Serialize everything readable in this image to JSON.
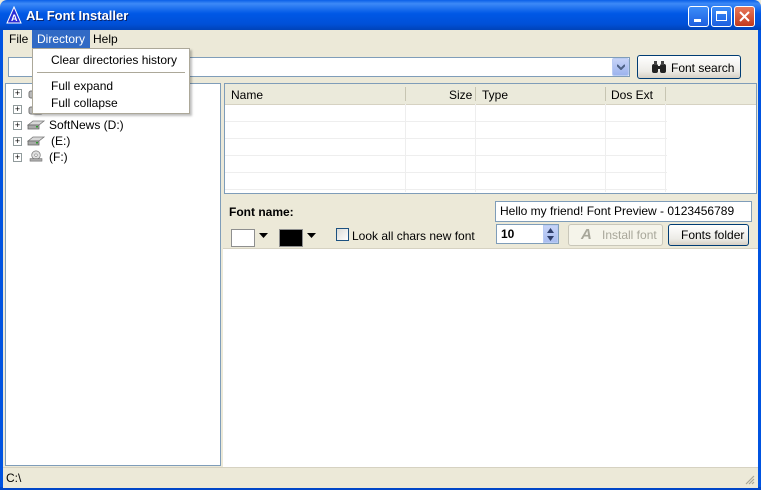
{
  "window": {
    "title": "AL Font Installer"
  },
  "menu": {
    "items": [
      "File",
      "Directory",
      "Help"
    ],
    "open_menu": "Directory",
    "directory_items": [
      "Clear directories history",
      "Full expand",
      "Full collapse"
    ]
  },
  "toolbar": {
    "path_value": "",
    "search_button": "Font search"
  },
  "tree": {
    "items": [
      {
        "label": "",
        "icon": "floppy-icon"
      },
      {
        "label": "",
        "icon": "drive-icon"
      },
      {
        "label": "SoftNews (D:)",
        "icon": "drive-icon"
      },
      {
        "label": "(E:)",
        "icon": "drive-icon"
      },
      {
        "label": "(F:)",
        "icon": "cd-drive-icon"
      }
    ]
  },
  "list": {
    "columns": [
      "Name",
      "Size",
      "Type",
      "Dos Ext"
    ],
    "rows": []
  },
  "preview": {
    "font_name_label": "Font name:",
    "preview_text": "Hello my friend! Font Preview - 0123456789",
    "look_all_label": "Look all chars new font",
    "look_all_checked": false,
    "size": "10",
    "install_button": "Install font",
    "fonts_folder_button": "Fonts folder",
    "bg_color": "#FFFFFF",
    "fg_color": "#000000"
  },
  "status": {
    "path": "C:\\"
  },
  "colors": {
    "titlebar": "#0058E6",
    "menu_highlight": "#316AC5",
    "face": "#ECE9D8"
  }
}
